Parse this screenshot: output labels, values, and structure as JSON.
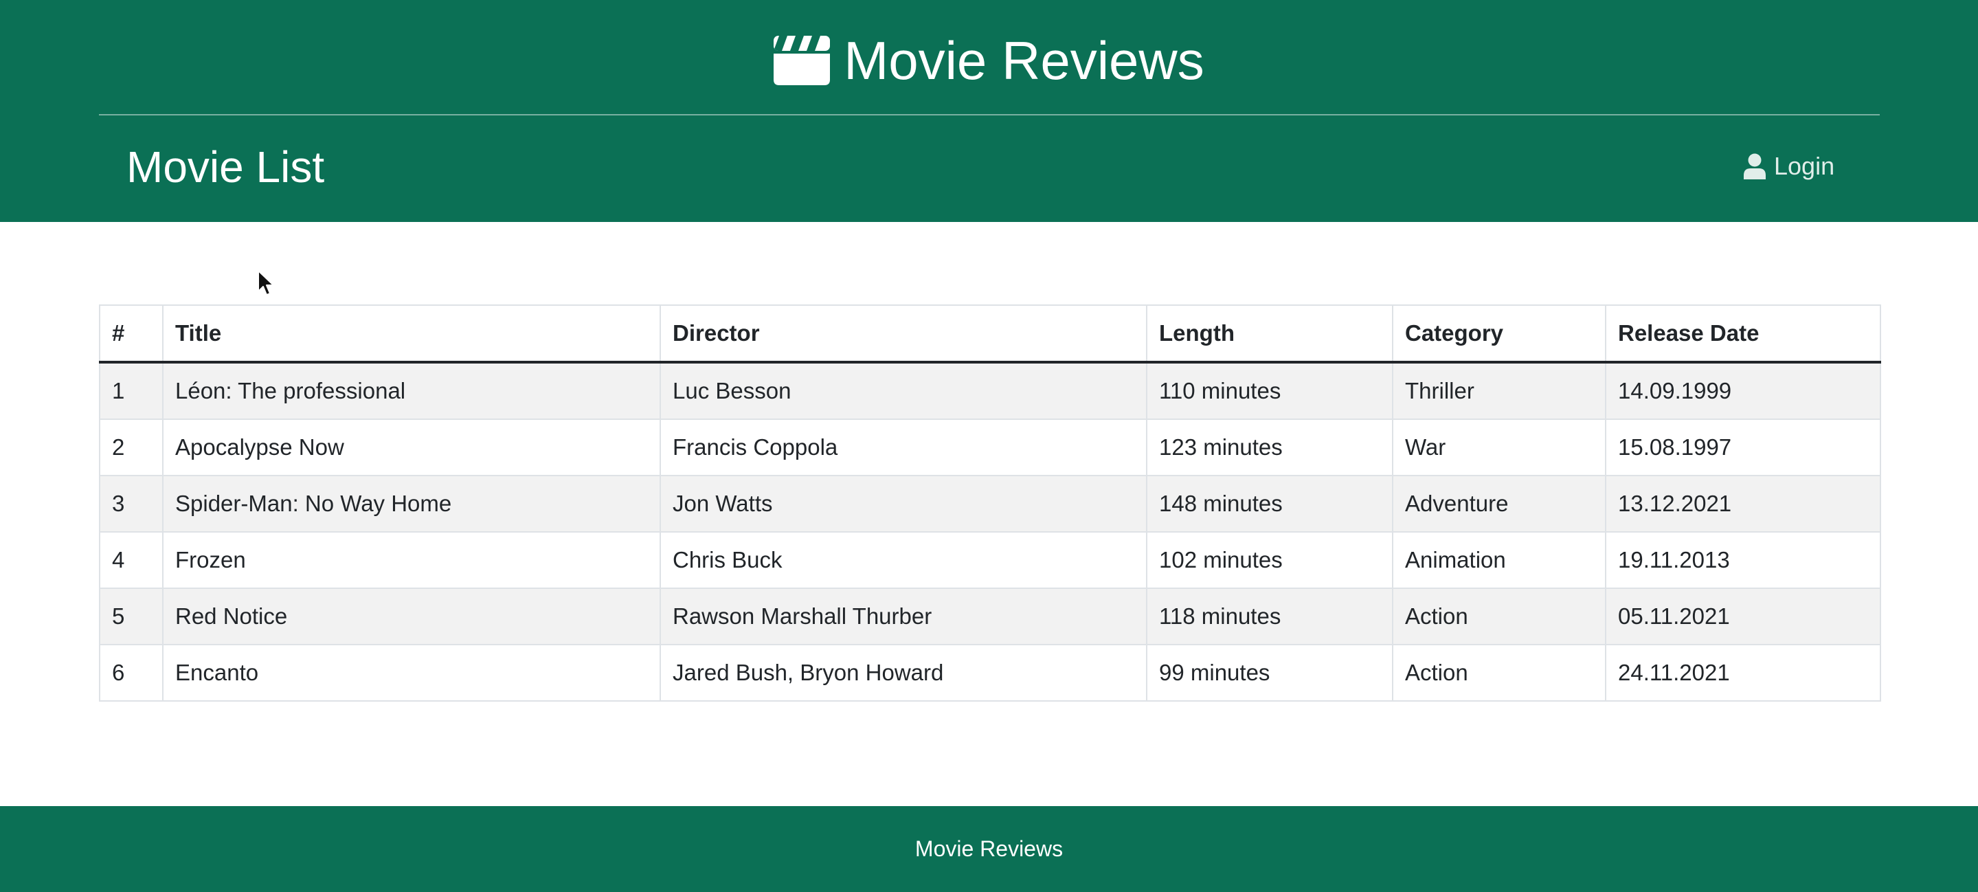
{
  "header": {
    "brand_icon": "clapperboard-icon",
    "brand_title": "Movie Reviews",
    "page_title": "Movie List",
    "login_icon": "user-icon",
    "login_label": "Login"
  },
  "table": {
    "columns": [
      "#",
      "Title",
      "Director",
      "Length",
      "Category",
      "Release Date"
    ],
    "rows": [
      [
        "1",
        "Léon: The professional",
        "Luc Besson",
        "110 minutes",
        "Thriller",
        "14.09.1999"
      ],
      [
        "2",
        "Apocalypse Now",
        "Francis Coppola",
        "123 minutes",
        "War",
        "15.08.1997"
      ],
      [
        "3",
        "Spider-Man: No Way Home",
        "Jon Watts",
        "148 minutes",
        "Adventure",
        "13.12.2021"
      ],
      [
        "4",
        "Frozen",
        "Chris Buck",
        "102 minutes",
        "Animation",
        "19.11.2013"
      ],
      [
        "5",
        "Red Notice",
        "Rawson Marshall Thurber",
        "118 minutes",
        "Action",
        "05.11.2021"
      ],
      [
        "6",
        "Encanto",
        "Jared Bush, Bryon Howard",
        "99 minutes",
        "Action",
        "24.11.2021"
      ]
    ]
  },
  "footer": {
    "text": "Movie Reviews"
  },
  "colors": {
    "brand_green": "#0b7055",
    "stripe": "#f2f2f2",
    "text": "#212529"
  }
}
